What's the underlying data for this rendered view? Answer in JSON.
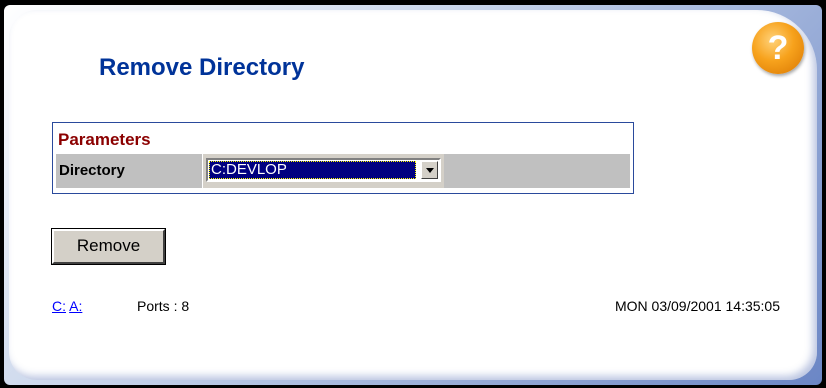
{
  "page": {
    "title": "Remove Directory",
    "help_icon": "question-mark-icon",
    "help_glyph": "?"
  },
  "parameters": {
    "header": "Parameters",
    "directory": {
      "label": "Directory",
      "selected": "C:DEVLOP"
    }
  },
  "actions": {
    "remove_label": "Remove"
  },
  "footer": {
    "link_c": "C:",
    "link_a": "A:",
    "ports": "Ports : 8",
    "datetime": "MON 03/09/2001 14:35:05"
  },
  "colors": {
    "title": "#003399",
    "section_header": "#8b0000",
    "selection_bg": "#000080",
    "help_orange": "#f7a21c",
    "link": "#0000ff"
  }
}
